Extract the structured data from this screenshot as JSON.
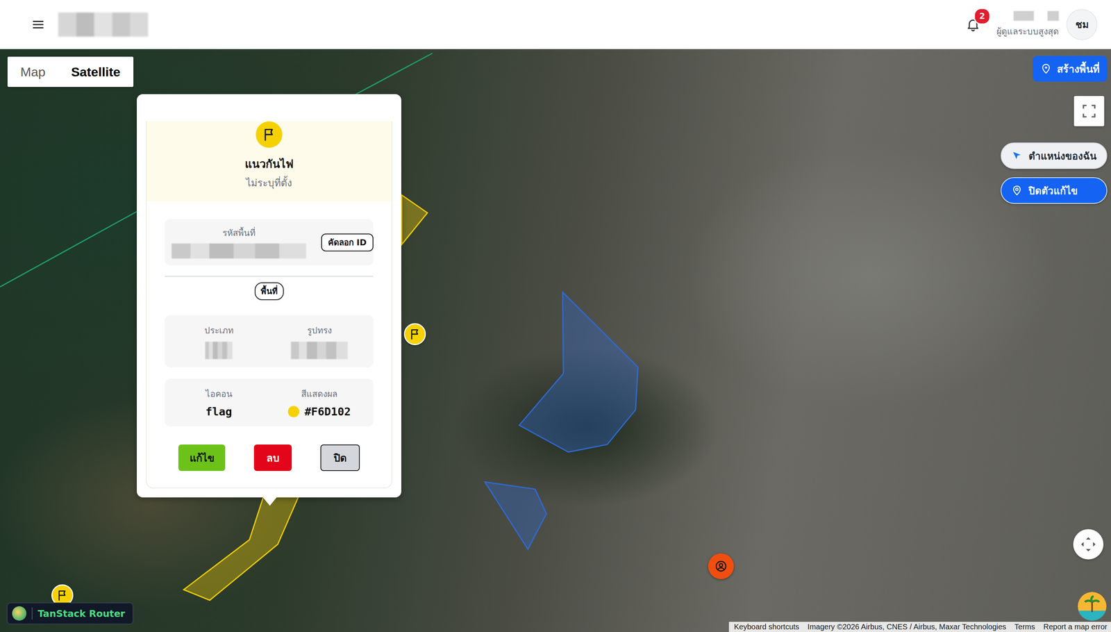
{
  "header": {
    "notification_count": "2",
    "user_role": "ผู้ดูแลระบบสูงสุด",
    "avatar_initials": "ชม"
  },
  "map_type_tabs": [
    {
      "label": "Map",
      "selected": false
    },
    {
      "label": "Satellite",
      "selected": true
    }
  ],
  "map_controls": {
    "create_button": "สร้างพื้นที่",
    "my_location_button": "ตำแหน่งของฉัน",
    "editor_toggle_button": "ปิดตัวแก้ไข"
  },
  "zones": [
    {
      "kind": "polygon",
      "color": "#2f6bd8"
    },
    {
      "kind": "polygon",
      "color": "#2f6bd8"
    },
    {
      "kind": "polygon",
      "color": "#F6D102"
    },
    {
      "kind": "polygon",
      "color": "#F6D102"
    },
    {
      "kind": "line",
      "color": "#1fa36b"
    }
  ],
  "markers": [
    {
      "kind": "flag",
      "color": "#F6D102"
    },
    {
      "kind": "flag",
      "color": "#F6D102"
    },
    {
      "kind": "person",
      "color": "#f04e0f"
    }
  ],
  "popup": {
    "icon": "flag",
    "color": "#F6D102",
    "title": "แนวกันไฟ",
    "subtitle": "ไม่ระบุที่ตั้ง",
    "id_label": "รหัสพื้นที่",
    "copy_button": "คัดลอก ID",
    "section_label": "พื้นที่",
    "fields": [
      {
        "label": "ประเภท"
      },
      {
        "label": "รูปทรง"
      }
    ],
    "icon_label": "ไอคอน",
    "color_label": "สีแสดงผล",
    "actions": [
      {
        "label": "แก้ไข",
        "kind": "edit"
      },
      {
        "label": "ลบ",
        "kind": "delete"
      },
      {
        "label": "ปิด",
        "kind": "close"
      }
    ]
  },
  "attribution": [
    "Keyboard shortcuts",
    "Imagery ©2026 Airbus, CNES / Airbus, Maxar Technologies",
    "Terms",
    "Report a map error"
  ],
  "devtools": {
    "label": "TanStack Router"
  }
}
